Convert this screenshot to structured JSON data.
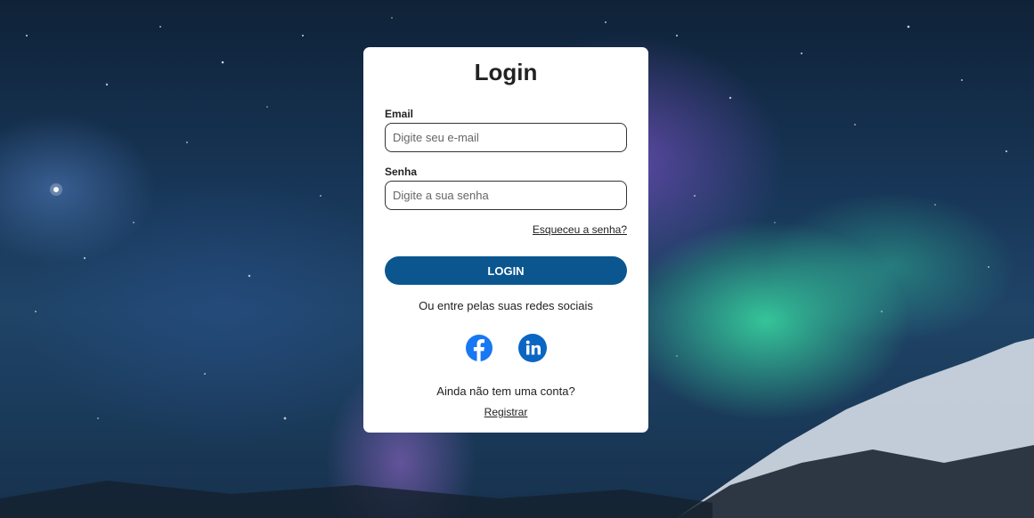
{
  "login": {
    "title": "Login",
    "email_label": "Email",
    "email_placeholder": "Digite seu e-mail",
    "email_value": "",
    "password_label": "Senha",
    "password_placeholder": "Digite a sua senha",
    "password_value": "",
    "forgot_link": "Esqueceu a senha?",
    "login_button": "LOGIN",
    "social_text": "Ou entre pelas suas redes sociais",
    "social_icons": [
      "facebook-icon",
      "linkedin-icon"
    ],
    "no_account_text": "Ainda não tem uma conta?",
    "register_link": "Registrar"
  },
  "colors": {
    "accent": "#0b568f",
    "facebook": "#1877f2",
    "linkedin": "#0a66c2",
    "card_background": "#ffffff"
  }
}
